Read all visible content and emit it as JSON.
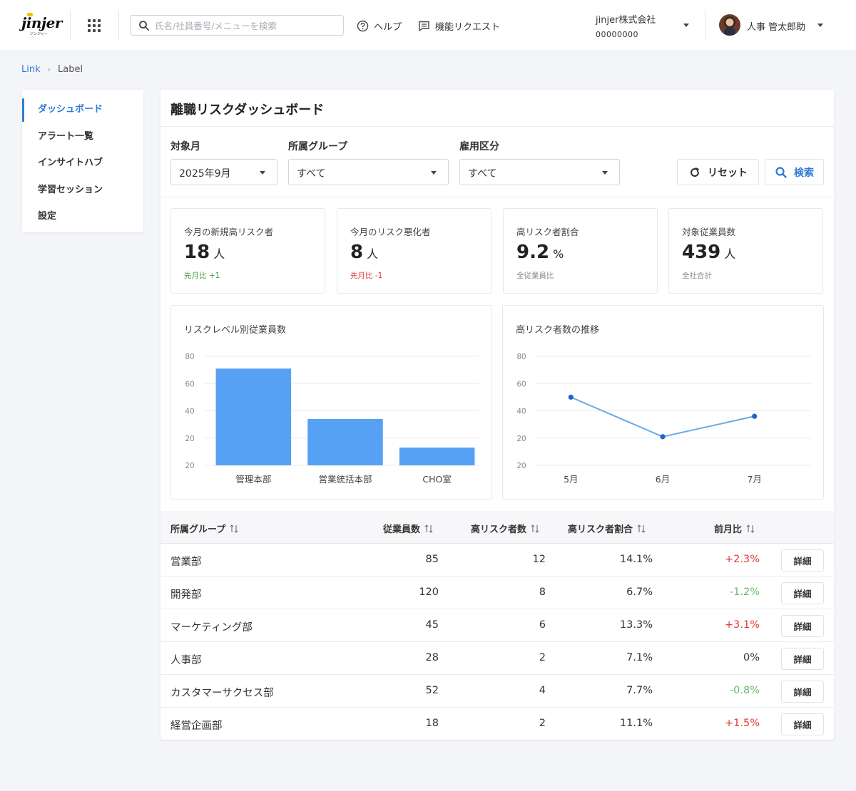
{
  "header": {
    "logo_text": "jinjer",
    "logo_sub": "ジンジャー",
    "search_placeholder": "氏名/社員番号/メニューを検索",
    "help_label": "ヘルプ",
    "request_label": "機能リクエスト",
    "company_name": "jinjer株式会社",
    "company_id": "00000000",
    "user_name": "人事 管太郎助"
  },
  "breadcrumb": {
    "link": "Link",
    "current": "Label"
  },
  "sidebar": {
    "items": [
      {
        "label": "ダッシュボード",
        "active": true
      },
      {
        "label": "アラート一覧"
      },
      {
        "label": "インサイトハブ"
      },
      {
        "label": "学習セッション"
      },
      {
        "label": "設定"
      }
    ]
  },
  "page_title": "離職リスクダッシュボード",
  "filters": {
    "month": {
      "label": "対象月",
      "value": "2025年9月"
    },
    "group": {
      "label": "所属グループ",
      "value": "すべて"
    },
    "employment": {
      "label": "雇用区分",
      "value": "すべて"
    },
    "reset_label": "リセット",
    "search_label": "検索"
  },
  "kpis": [
    {
      "title": "今月の新規高リスク者",
      "value": "18",
      "unit": "人",
      "note": "先月比 +1",
      "note_type": "up"
    },
    {
      "title": "今月のリスク悪化者",
      "value": "8",
      "unit": "人",
      "note": "先月比 -1",
      "note_type": "down"
    },
    {
      "title": "高リスク者割合",
      "value": "9.2",
      "unit": "%",
      "note": "全従業員比",
      "note_type": "neutral"
    },
    {
      "title": "対象従業員数",
      "value": "439",
      "unit": "人",
      "note": "全社合計",
      "note_type": "neutral"
    }
  ],
  "chart_data": [
    {
      "type": "bar",
      "title": "リスクレベル別従業員数",
      "categories": [
        "管理本部",
        "営業統括本部",
        "CHO室"
      ],
      "values": [
        71,
        34,
        13
      ],
      "ylim": [
        0,
        80
      ],
      "y_ticks": [
        "20",
        "20",
        "40",
        "60",
        "80"
      ],
      "grid": true,
      "color": "#56a1f3"
    },
    {
      "type": "line",
      "title": "高リスク者数の推移",
      "categories": [
        "5月",
        "6月",
        "7月"
      ],
      "values": [
        50,
        21,
        36
      ],
      "ylim": [
        0,
        80
      ],
      "y_ticks": [
        "20",
        "20",
        "40",
        "60",
        "80"
      ],
      "grid": true,
      "color": "#6aaae6",
      "point_color": "#1e66c9"
    }
  ],
  "table": {
    "columns": [
      "所属グループ",
      "従業員数",
      "高リスク者数",
      "高リスク者割合",
      "前月比"
    ],
    "detail_label": "詳細",
    "rows": [
      {
        "group": "営業部",
        "employees": "85",
        "high_risk": "12",
        "ratio": "14.1%",
        "change": "+2.3%",
        "change_type": "pos"
      },
      {
        "group": "開発部",
        "employees": "120",
        "high_risk": "8",
        "ratio": "6.7%",
        "change": "-1.2%",
        "change_type": "neg"
      },
      {
        "group": "マーケティング部",
        "employees": "45",
        "high_risk": "6",
        "ratio": "13.3%",
        "change": "+3.1%",
        "change_type": "pos"
      },
      {
        "group": "人事部",
        "employees": "28",
        "high_risk": "2",
        "ratio": "7.1%",
        "change": "0%",
        "change_type": "zero"
      },
      {
        "group": "カスタマーサクセス部",
        "employees": "52",
        "high_risk": "4",
        "ratio": "7.7%",
        "change": "-0.8%",
        "change_type": "neg"
      },
      {
        "group": "経営企画部",
        "employees": "18",
        "high_risk": "2",
        "ratio": "11.1%",
        "change": "+1.5%",
        "change_type": "pos"
      }
    ]
  }
}
